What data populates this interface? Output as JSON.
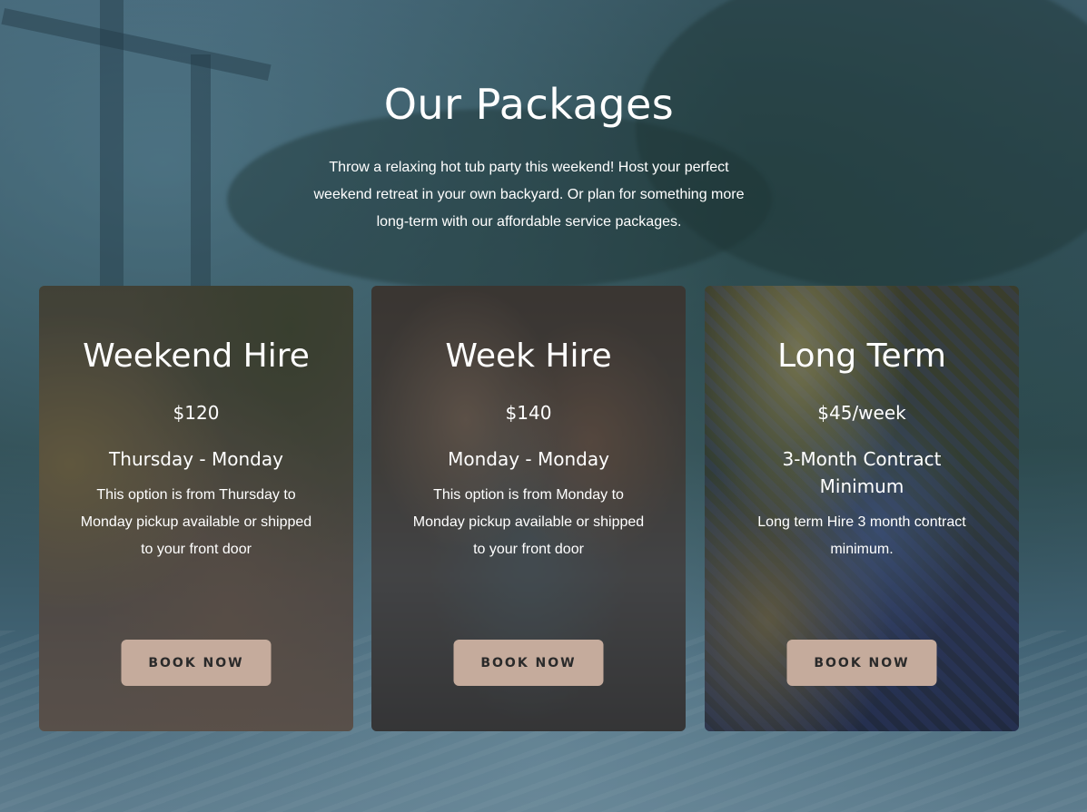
{
  "section": {
    "title": "Our Packages",
    "intro": "Throw a relaxing hot tub party this weekend! Host your perfect weekend retreat in your own backyard. Or plan for something more long-term with our affordable service packages."
  },
  "packages": [
    {
      "name": "Weekend Hire",
      "price": "$120",
      "period": "Thursday - Monday",
      "description": "This option is from Thursday to Monday pickup available or shipped to your front door",
      "button": "BOOK NOW"
    },
    {
      "name": "Week Hire",
      "price": "$140",
      "period": "Monday - Monday",
      "description": "This option is from Monday to Monday pickup available or shipped to your front door",
      "button": "BOOK NOW"
    },
    {
      "name": "Long Term",
      "price": "$45/week",
      "period": "3-Month Contract Minimum",
      "description": "Long term Hire 3 month contract minimum.",
      "button": "BOOK NOW"
    }
  ],
  "colors": {
    "button_bg": "#c5ab9c",
    "button_text": "#2a2a2a",
    "text": "#ffffff"
  }
}
